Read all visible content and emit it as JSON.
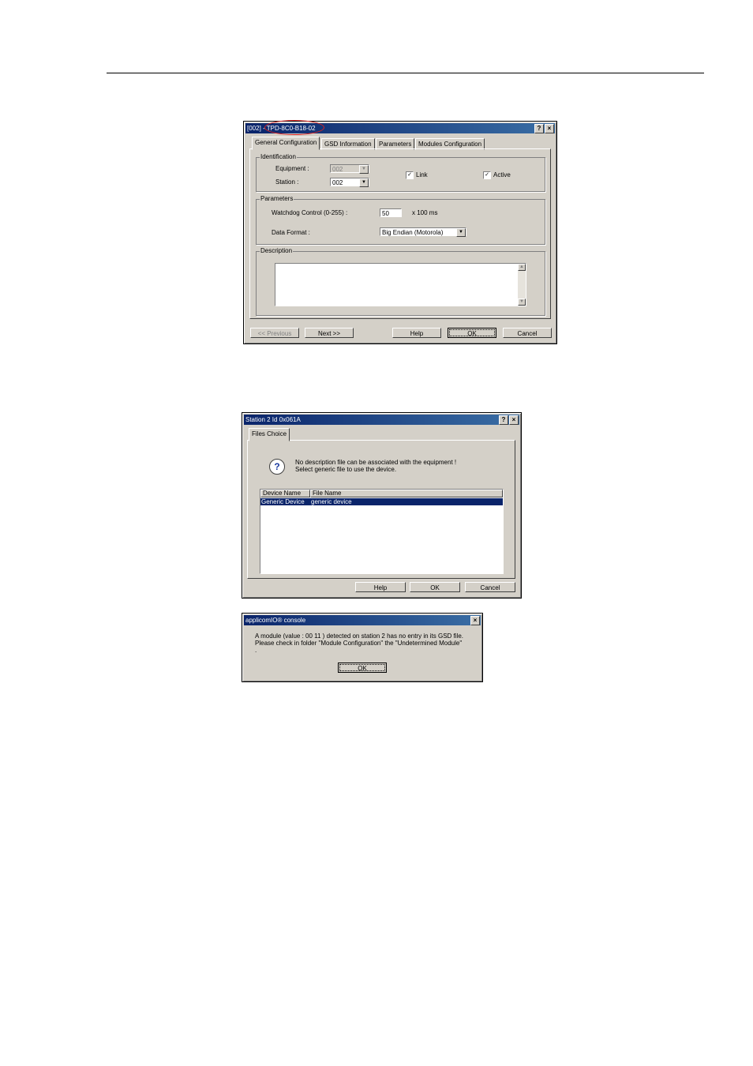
{
  "dialog1": {
    "title": "[002] - TPD-8C0-B18-02",
    "help_icon": "?",
    "close_icon": "×",
    "tabs": [
      "General Configuration",
      "GSD Information",
      "Parameters",
      "Modules Configuration"
    ],
    "identification": {
      "legend": "Identification",
      "equipment_label": "Equipment :",
      "equipment_value": "002",
      "station_label": "Station :",
      "station_value": "002",
      "link_label": "Link",
      "active_label": "Active"
    },
    "parameters": {
      "legend": "Parameters",
      "watchdog_label": "Watchdog Control (0-255) :",
      "watchdog_value": "50",
      "watchdog_unit": "x 100 ms",
      "data_format_label": "Data Format :",
      "data_format_value": "Big Endian (Motorola)"
    },
    "description": {
      "legend": "Description"
    },
    "buttons": {
      "previous": "<< Previous",
      "next": "Next >>",
      "help": "Help",
      "ok": "OK",
      "cancel": "Cancel"
    }
  },
  "dialog2": {
    "title": "Station 2 Id 0x061A",
    "tab": "Files Choice",
    "message_line1": "No description file can be associated with the equipment !",
    "message_line2": "Select generic file to use the device.",
    "columns": [
      "Device Name",
      "File Name"
    ],
    "rows": [
      {
        "device": "Generic Device",
        "file": "generic device"
      }
    ],
    "buttons": {
      "help": "Help",
      "ok": "OK",
      "cancel": "Cancel"
    }
  },
  "dialog3": {
    "title": "applicomIO® console",
    "message_line1": "A module (value : 00 11 ) detected on station 2 has no entry in its GSD file.",
    "message_line2": "Please check in folder \"Module Configuration\" the \"Undetermined Module\"",
    "message_line3": ".",
    "ok": "OK"
  }
}
